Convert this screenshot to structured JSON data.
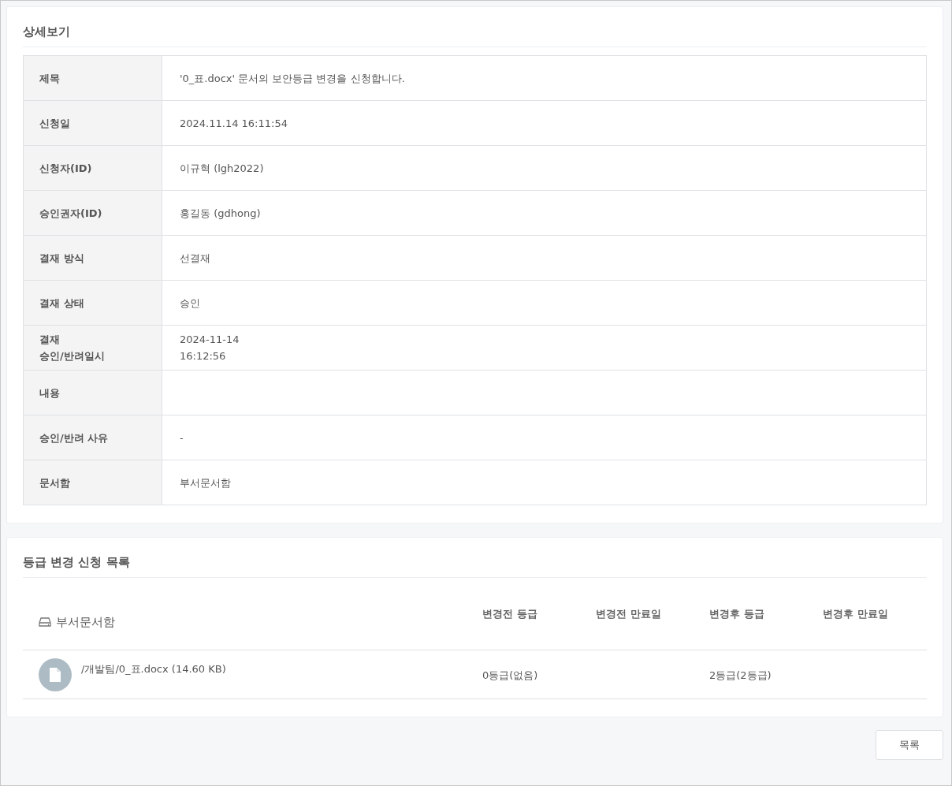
{
  "detail": {
    "title": "상세보기",
    "rows": [
      {
        "label": "제목",
        "value": "'0_표.docx' 문서의 보안등급 변경을 신청합니다."
      },
      {
        "label": "신청일",
        "value": "2024.11.14 16:11:54"
      },
      {
        "label": "신청자(ID)",
        "value": "이규혁 (lgh2022)"
      },
      {
        "label": "승인권자(ID)",
        "value": "홍길동 (gdhong)"
      },
      {
        "label": "결재 방식",
        "value": "선결재"
      },
      {
        "label": "결재 상태",
        "value": "승인"
      },
      {
        "label": "결재\n승인/반려일시",
        "value": "2024-11-14\n16:12:56"
      },
      {
        "label": "내용"
      },
      {
        "label": "승인/반려 사유",
        "value": "-"
      },
      {
        "label": "문서함",
        "value": "부서문서함"
      }
    ]
  },
  "grade_list": {
    "title": "등급 변경 신청 목록",
    "folder": "부서문서함",
    "columns": [
      "변경전 등급",
      "변경전 만료일",
      "변경후 등급",
      "변경후 만료일"
    ],
    "rows": [
      {
        "file": "/개발팀/0_표.docx (14.60 KB)",
        "cells": [
          "0등급(없음)",
          null,
          "2등급(2등급)",
          null
        ]
      }
    ]
  },
  "buttons": [
    "목록"
  ]
}
